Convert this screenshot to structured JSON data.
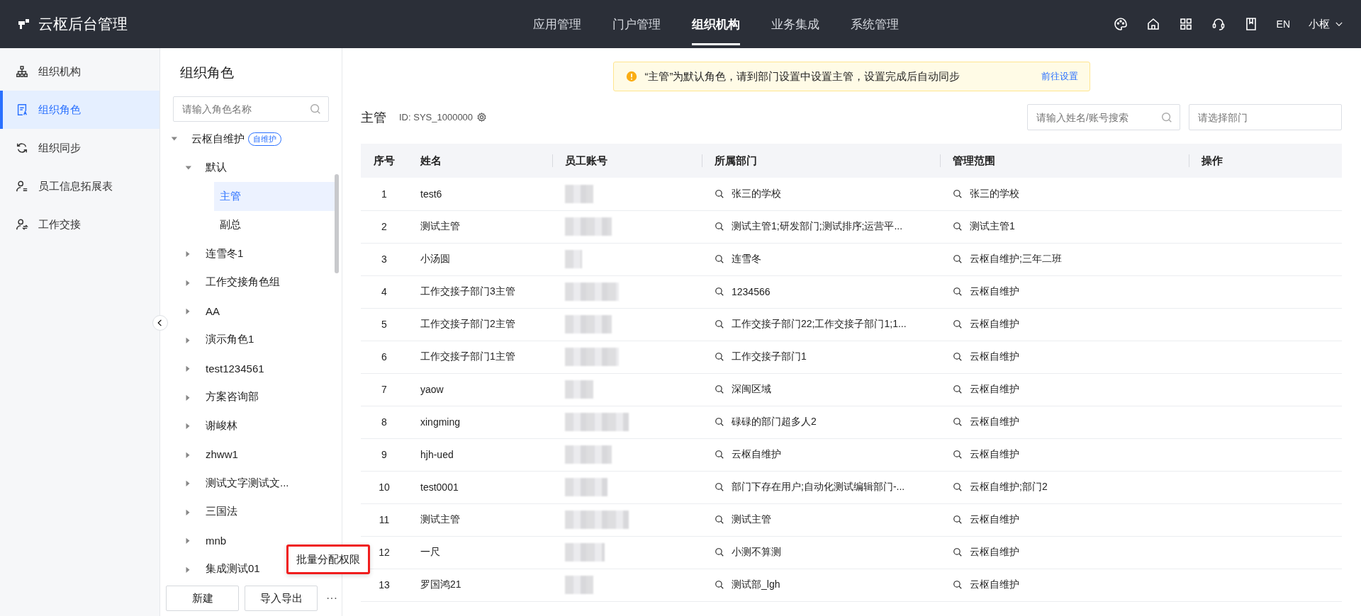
{
  "header": {
    "logo": "云枢后台管理",
    "nav": [
      {
        "label": "应用管理",
        "selected": false
      },
      {
        "label": "门户管理",
        "selected": false
      },
      {
        "label": "组织机构",
        "selected": true
      },
      {
        "label": "业务集成",
        "selected": false
      },
      {
        "label": "系统管理",
        "selected": false
      }
    ],
    "lang": "EN",
    "user": "小枢"
  },
  "sidebar": {
    "items": [
      {
        "label": "组织机构",
        "selected": false
      },
      {
        "label": "组织角色",
        "selected": true
      },
      {
        "label": "组织同步",
        "selected": false
      },
      {
        "label": "员工信息拓展表",
        "selected": false
      },
      {
        "label": "工作交接",
        "selected": false
      }
    ]
  },
  "role_panel": {
    "title": "组织角色",
    "search": {
      "placeholder": "请输入角色名称"
    },
    "tree": [
      {
        "label": "云枢自维护",
        "badge": "自维护",
        "expanded": true,
        "selected": false,
        "children": [
          {
            "label": "默认",
            "expanded": true,
            "selected": false,
            "children": [
              {
                "label": "主管",
                "selected": true
              },
              {
                "label": "副总",
                "selected": false
              }
            ]
          },
          {
            "label": "连雪冬1",
            "expanded": false,
            "selected": false
          },
          {
            "label": "工作交接角色组",
            "expanded": false,
            "selected": false
          },
          {
            "label": "AA",
            "expanded": false,
            "selected": false
          },
          {
            "label": "演示角色1",
            "expanded": false,
            "selected": false
          },
          {
            "label": "test1234561",
            "expanded": false,
            "selected": false
          },
          {
            "label": "方案咨询部",
            "expanded": false,
            "selected": false
          },
          {
            "label": "谢峻林",
            "expanded": false,
            "selected": false
          },
          {
            "label": "zhww1",
            "expanded": false,
            "selected": false
          },
          {
            "label": "测试文字测试文...",
            "expanded": false,
            "selected": false
          },
          {
            "label": "三国法",
            "expanded": false,
            "selected": false
          },
          {
            "label": "mnb",
            "expanded": false,
            "selected": false
          },
          {
            "label": "集成测试01",
            "expanded": false,
            "selected": false
          }
        ]
      }
    ],
    "buttons": [
      "新建",
      "导入导出"
    ],
    "more": "···",
    "popup_menu": [
      "批量分配权限"
    ]
  },
  "notice": {
    "text": "“主管”为默认角色，请到部门设置中设置主管，设置完成后自动同步",
    "link": "前往设置"
  },
  "role": {
    "name": "主管",
    "id": "ID: SYS_1000000"
  },
  "filters": {
    "search": {
      "placeholder": "请输入姓名/账号搜索"
    },
    "department": {
      "placeholder": "请选择部门"
    }
  },
  "table": {
    "columns": [
      "序号",
      "姓名",
      "员工账号",
      "所属部门",
      "管理范围",
      "操作"
    ],
    "rows": [
      {
        "cells": [
          "1",
          "test6",
          "",
          "张三的学校",
          "张三的学校",
          ""
        ]
      },
      {
        "cells": [
          "2",
          "测试主管",
          "",
          "测试主管1;研发部门;测试排序;运营平...",
          "测试主管1",
          ""
        ]
      },
      {
        "cells": [
          "3",
          "小汤圆",
          "",
          "连雪冬",
          "云枢自维护;三年二班",
          ""
        ]
      },
      {
        "cells": [
          "4",
          "工作交接子部门3主管",
          "",
          "1234566",
          "云枢自维护",
          ""
        ]
      },
      {
        "cells": [
          "5",
          "工作交接子部门2主管",
          "",
          "工作交接子部门22;工作交接子部门1;1...",
          "云枢自维护",
          ""
        ]
      },
      {
        "cells": [
          "6",
          "工作交接子部门1主管",
          "",
          "工作交接子部门1",
          "云枢自维护",
          ""
        ]
      },
      {
        "cells": [
          "7",
          "yaow",
          "",
          "深闽区域",
          "云枢自维护",
          ""
        ]
      },
      {
        "cells": [
          "8",
          "xingming",
          "",
          "碌碌的部门超多人2",
          "云枢自维护",
          ""
        ]
      },
      {
        "cells": [
          "9",
          "hjh-ued",
          "",
          "云枢自维护",
          "云枢自维护",
          ""
        ]
      },
      {
        "cells": [
          "10",
          "test0001",
          "",
          "部门下存在用户;自动化测试编辑部门-...",
          "云枢自维护;部门2",
          ""
        ]
      },
      {
        "cells": [
          "11",
          "测试主管",
          "",
          "测试主管",
          "云枢自维护",
          ""
        ]
      },
      {
        "cells": [
          "12",
          "一尺",
          "",
          "小测不算测",
          "云枢自维护",
          ""
        ]
      },
      {
        "cells": [
          "13",
          "罗国鸿21",
          "",
          "测试部_lgh",
          "云枢自维护",
          ""
        ]
      }
    ]
  }
}
